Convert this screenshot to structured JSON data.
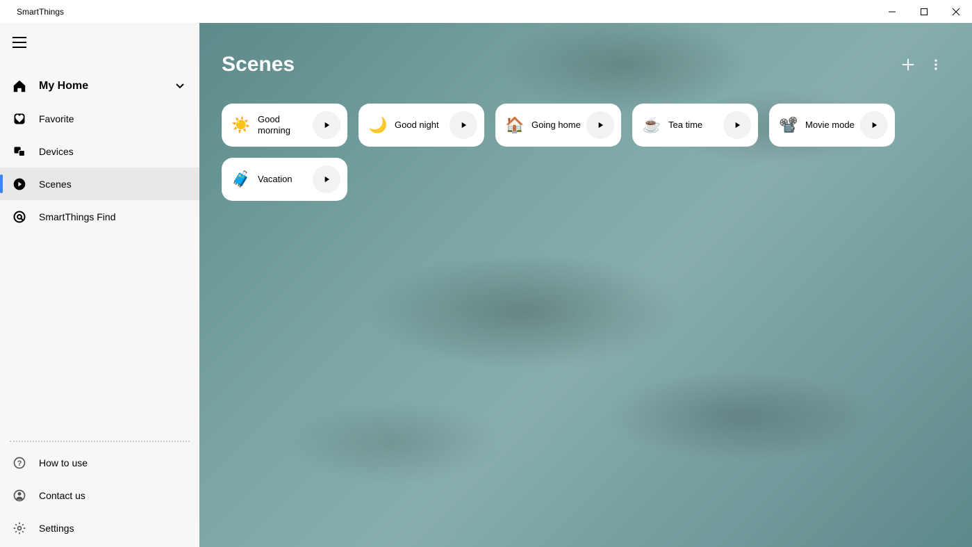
{
  "app": {
    "title": "SmartThings"
  },
  "sidebar": {
    "home_label": "My Home",
    "nav": [
      {
        "id": "favorite",
        "label": "Favorite"
      },
      {
        "id": "devices",
        "label": "Devices"
      },
      {
        "id": "scenes",
        "label": "Scenes"
      },
      {
        "id": "find",
        "label": "SmartThings Find"
      }
    ],
    "bottom": [
      {
        "id": "howto",
        "label": "How to use"
      },
      {
        "id": "contact",
        "label": "Contact us"
      },
      {
        "id": "settings",
        "label": "Settings"
      }
    ]
  },
  "main": {
    "title": "Scenes",
    "scenes": [
      {
        "id": "good-morning",
        "label": "Good morning",
        "emoji": "☀️"
      },
      {
        "id": "good-night",
        "label": "Good night",
        "emoji": "🌙"
      },
      {
        "id": "going-home",
        "label": "Going home",
        "emoji": "🏠"
      },
      {
        "id": "tea-time",
        "label": "Tea time",
        "emoji": "☕"
      },
      {
        "id": "movie-mode",
        "label": "Movie mode",
        "emoji": "📽️"
      },
      {
        "id": "vacation",
        "label": "Vacation",
        "emoji": "🧳"
      }
    ]
  }
}
